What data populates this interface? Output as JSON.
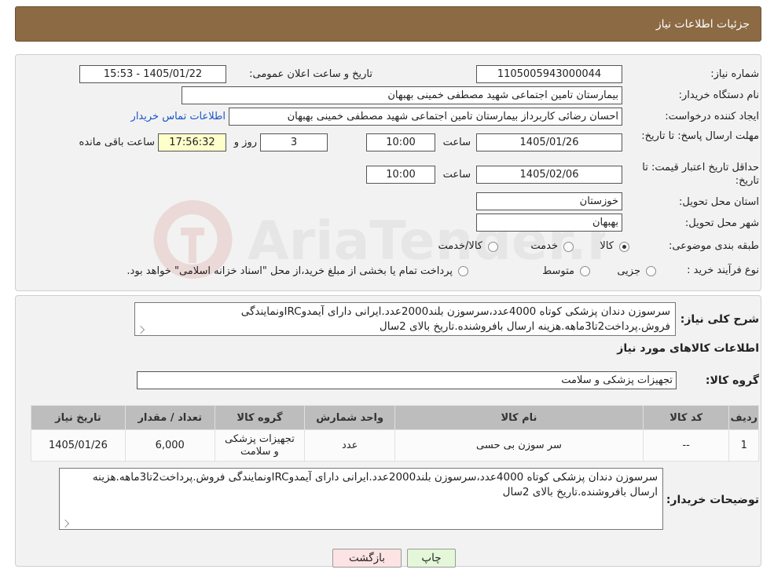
{
  "header": {
    "title": "جزئیات اطلاعات نیاز"
  },
  "form": {
    "need_number_label": "شماره نیاز:",
    "need_number": "1105005943000044",
    "announce_label": "تاریخ و ساعت اعلان عمومی:",
    "announce_value": "1405/01/22 - 15:53",
    "buyer_org_label": "نام دستگاه خریدار:",
    "buyer_org": "بیمارستان تامین اجتماعی شهید مصطفی خمینی بهبهان",
    "creator_label": "ایجاد کننده درخواست:",
    "creator": "احسان رضائی کاربرداز بیمارستان تامین اجتماعی شهید مصطفی خمینی بهبهان",
    "contact_link": "اطلاعات تماس خریدار",
    "reply_deadline_label": "مهلت ارسال پاسخ: تا تاریخ:",
    "reply_date": "1405/01/26",
    "time_label": "ساعت",
    "reply_time": "10:00",
    "days_value": "3",
    "days_label": "روز و",
    "remaining_time": "17:56:32",
    "remaining_label": "ساعت باقی مانده",
    "price_validity_label": "حداقل تاریخ اعتبار قیمت: تا تاریخ:",
    "price_date": "1405/02/06",
    "price_time": "10:00",
    "province_label": "استان محل تحویل:",
    "province": "خوزستان",
    "city_label": "شهر محل تحویل:",
    "city": "بهبهان",
    "category_label": "طبقه بندی موضوعی:",
    "category_options": [
      "کالا",
      "خدمت",
      "کالا/خدمت"
    ],
    "process_label": "نوع فرآیند خرید :",
    "process_options": [
      "جزیی",
      "متوسط"
    ],
    "process_note": "پرداخت تمام یا بخشی از مبلغ خرید،از محل \"اسناد خزانه اسلامی\" خواهد بود."
  },
  "summary": {
    "label": "شرح کلی نیاز:",
    "text": "سرسوزن دندان پزشکی کوتاه 4000عدد،سرسوزن بلند2000عدد.ایرانی دارای آیمدوIRCونمایندگی فروش.پرداخت2تا3ماهه.هزینه ارسال بافروشنده.تاریخ بالای 2سال"
  },
  "items_section": {
    "title": "اطلاعات کالاهای مورد نیاز",
    "group_label": "گروه کالا:",
    "group_value": "تجهیزات پزشکی و سلامت"
  },
  "table": {
    "headers": [
      "ردیف",
      "کد کالا",
      "نام کالا",
      "واحد شمارش",
      "گروه کالا",
      "تعداد / مقدار",
      "تاریخ نیاز"
    ],
    "rows": [
      [
        "1",
        "--",
        "سر سوزن بی حسی",
        "عدد",
        "تجهیزات پزشکی و سلامت",
        "6,000",
        "1405/01/26"
      ]
    ]
  },
  "buyer_notes": {
    "label": "توضیحات خریدار:",
    "text": "سرسوزن دندان پزشکی کوتاه 4000عدد،سرسوزن بلند2000عدد.ایرانی دارای آیمدوIRCونمایندگی فروش.پرداخت2تا3ماهه.هزینه ارسال بافروشنده.تاریخ بالای 2سال"
  },
  "buttons": {
    "print": "چاپ",
    "back": "بازگشت"
  },
  "watermark": {
    "text": "AriaTender.neT"
  },
  "colors": {
    "header_bg": "#8c6a44",
    "panel_bg": "#f2f2f2",
    "back_button": "#fde3e3",
    "print_button": "#e4f7d9",
    "link": "#1a55c8"
  }
}
